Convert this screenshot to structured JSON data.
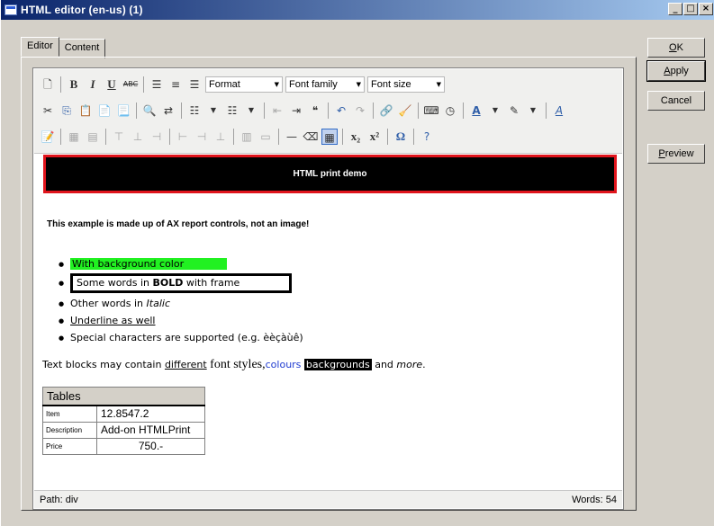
{
  "window": {
    "title": "HTML editor  (en-us) (1)",
    "controls": [
      "_",
      "□",
      "×"
    ]
  },
  "tabs": [
    {
      "label": "Editor"
    },
    {
      "label": "Content"
    }
  ],
  "toolbar": {
    "format_label": "Format",
    "font_family_label": "Font family",
    "font_size_label": "Font size"
  },
  "content": {
    "banner": "HTML print demo",
    "intro": "This example is made up of AX report controls, not an image!",
    "list": [
      "With background color",
      "Some words in ",
      "BOLD",
      " with frame",
      "Other words in ",
      "Italic",
      "Underline as well",
      "Special characters are supported (e.g. èèçàùê)"
    ],
    "mixed": {
      "prefix": "Text blocks may contain ",
      "different": "different",
      "font_styles": " font styles,",
      "colours": "colours",
      "backgrounds": "backgrounds",
      "and": " and ",
      "more": "more",
      "dot": "."
    },
    "table": {
      "header": "Tables",
      "rows": [
        {
          "label": "Item",
          "value": "12.8547.2"
        },
        {
          "label": "Description",
          "value": "Add-on HTMLPrint"
        },
        {
          "label": "Price",
          "value": "750.-"
        }
      ]
    }
  },
  "status": {
    "path": "Path: div",
    "words": "Words: 54"
  },
  "buttons": {
    "ok": {
      "mnemonic": "O",
      "rest": "K"
    },
    "apply": {
      "mnemonic": "A",
      "rest": "pply"
    },
    "cancel": "Cancel",
    "preview": {
      "mnemonic": "P",
      "rest": "review"
    }
  }
}
